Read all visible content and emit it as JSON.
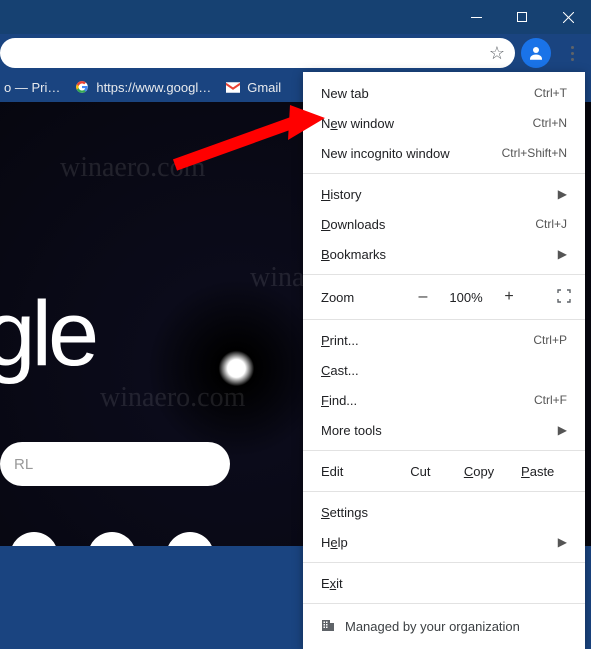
{
  "window": {
    "minimize": "–",
    "maximize": "▢",
    "close": "✕"
  },
  "bookmarks": {
    "item1": "o — Pri…",
    "item2": "https://www.googl…",
    "item3": "Gmail"
  },
  "page": {
    "logo": "oogle",
    "search_placeholder": "RL",
    "watermark": "winaero.com"
  },
  "menu": {
    "new_tab": "New tab",
    "new_tab_sc": "Ctrl+T",
    "new_window_pre": "N",
    "new_window_u": "e",
    "new_window_post": "w window",
    "new_window_sc": "Ctrl+N",
    "incognito": "New incognito window",
    "incognito_sc": "Ctrl+Shift+N",
    "history_u": "H",
    "history_post": "istory",
    "downloads_u": "D",
    "downloads_post": "ownloads",
    "downloads_sc": "Ctrl+J",
    "bookmarks_u": "B",
    "bookmarks_post": "ookmarks",
    "zoom": "Zoom",
    "zoom_minus": "–",
    "zoom_val": "100%",
    "zoom_plus": "+",
    "print_u": "P",
    "print_post": "rint...",
    "print_sc": "Ctrl+P",
    "cast_u": "C",
    "cast_post": "ast...",
    "find_u": "F",
    "find_post": "ind...",
    "find_sc": "Ctrl+F",
    "more_tools": "More tools",
    "edit": "Edit",
    "cut": "Cut",
    "copy_u": "C",
    "copy_post": "opy",
    "paste_u": "P",
    "paste_post": "aste",
    "settings_u": "S",
    "settings_post": "ettings",
    "help": "H",
    "help_u": "e",
    "help_post": "lp",
    "exit_pre": "E",
    "exit_u": "x",
    "exit_post": "it",
    "managed": "Managed by your organization"
  }
}
